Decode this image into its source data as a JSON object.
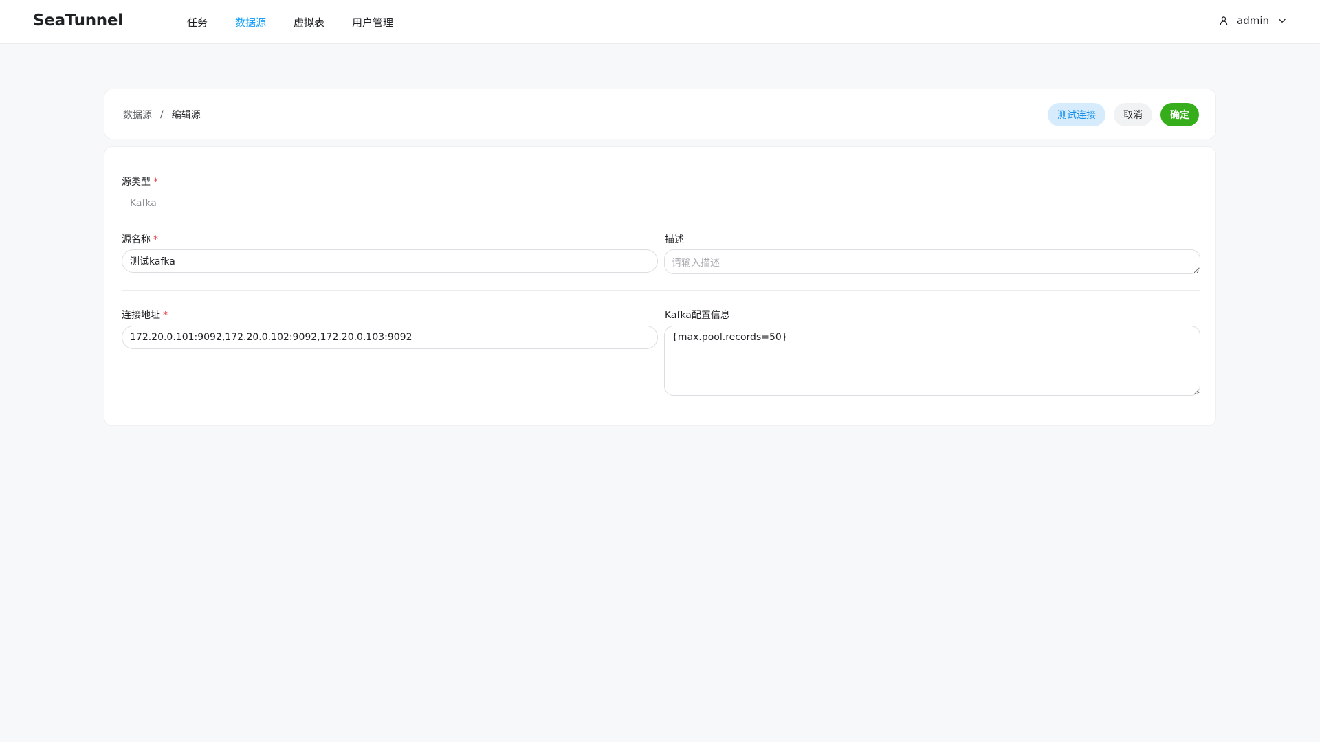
{
  "app": {
    "brand": "SeaTunnel"
  },
  "nav": {
    "items": [
      {
        "label": "任务"
      },
      {
        "label": "数据源",
        "active": true
      },
      {
        "label": "虚拟表"
      },
      {
        "label": "用户管理"
      }
    ]
  },
  "user": {
    "name": "admin",
    "icon": "user-icon",
    "dropdown_icon": "chevron-down-icon"
  },
  "breadcrumb": {
    "parent": "数据源",
    "separator": "/",
    "current": "编辑源"
  },
  "actions": {
    "test_label": "测试连接",
    "cancel_label": "取消",
    "confirm_label": "确定"
  },
  "form": {
    "source_type": {
      "label": "源类型",
      "required_mark": "*",
      "value": "Kafka"
    },
    "source_name": {
      "label": "源名称",
      "required_mark": "*",
      "value": "测试kafka"
    },
    "description": {
      "label": "描述",
      "value": "",
      "placeholder": "请输入描述"
    },
    "address": {
      "label": "连接地址",
      "required_mark": "*",
      "value": "172.20.0.101:9092,172.20.0.102:9092,172.20.0.103:9092"
    },
    "kafka_config": {
      "label": "Kafka配置信息",
      "value": "{max.pool.records=50}"
    }
  },
  "colors": {
    "accent": "#18a0fb",
    "confirm": "#36ad1a",
    "required": "#e5484d",
    "test_bg": "#d6ecfd"
  }
}
